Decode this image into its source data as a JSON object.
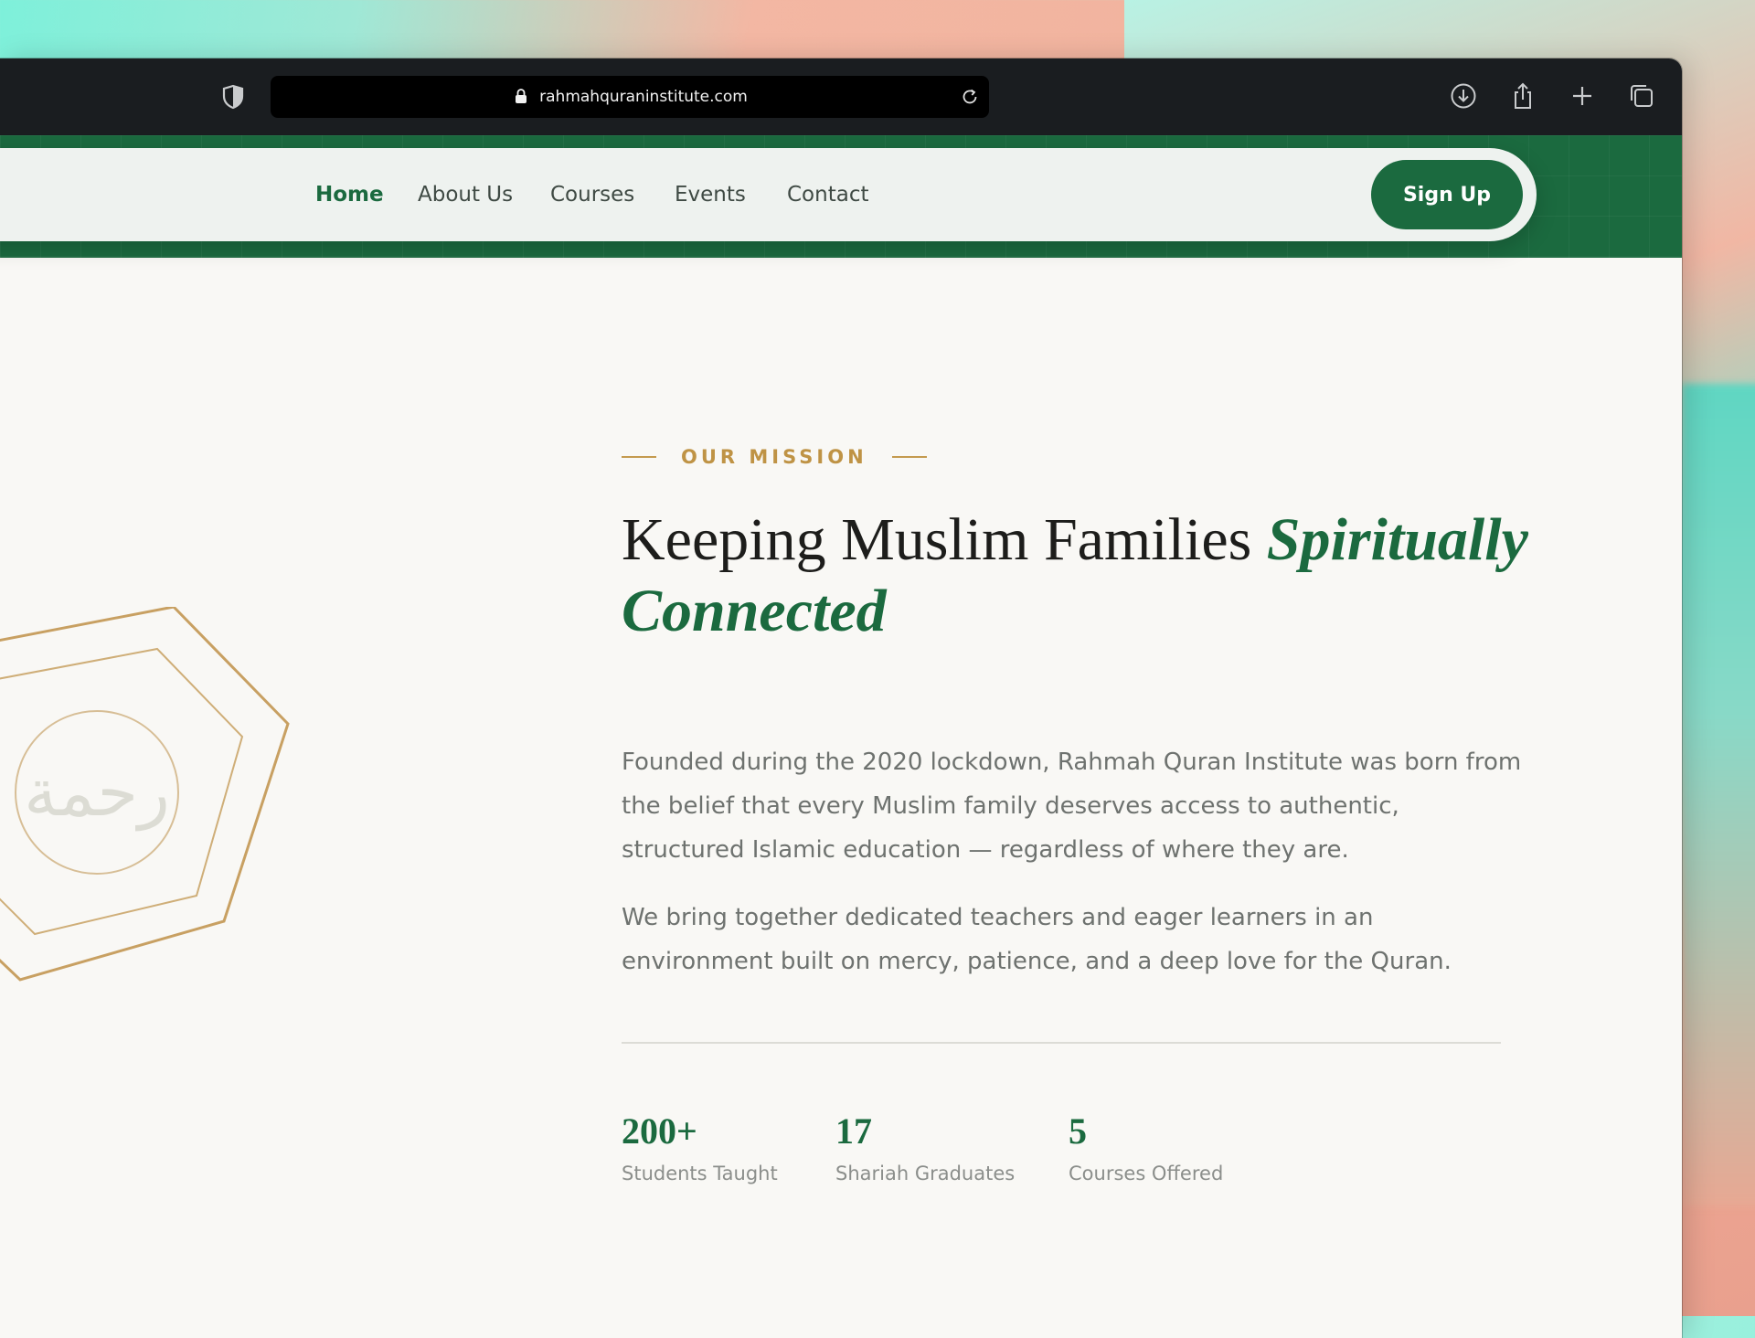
{
  "browser": {
    "url": "rahmahquraninstitute.com"
  },
  "nav": {
    "items": [
      {
        "label": "Home"
      },
      {
        "label": "About Us"
      },
      {
        "label": "Courses"
      },
      {
        "label": "Events"
      },
      {
        "label": "Contact"
      }
    ],
    "active": "Home",
    "signup_label": "Sign Up"
  },
  "emblem": {
    "arabic_text": "رحمة"
  },
  "mission": {
    "eyebrow": "OUR MISSION",
    "headline_plain": "Keeping Muslim Families ",
    "headline_highlight": "Spiritually Connected",
    "paragraph_1": "Founded during the 2020 lockdown, Rahmah Quran Institute was born from the belief that every Muslim family deserves access to authentic, structured Islamic education — regardless of where they are.",
    "paragraph_2": "We bring together dedicated teachers and eager learners in an environment built on mercy, patience, and a deep love for the Quran."
  },
  "stats": [
    {
      "value": "200+",
      "label": "Students Taught"
    },
    {
      "value": "17",
      "label": "Shariah Graduates"
    },
    {
      "value": "5",
      "label": "Courses Offered"
    }
  ],
  "colors": {
    "brand_green": "#1b6a3f",
    "gold": "#c49a4e",
    "toolbar": "#1a1d20",
    "page_bg": "#f9f8f5"
  }
}
